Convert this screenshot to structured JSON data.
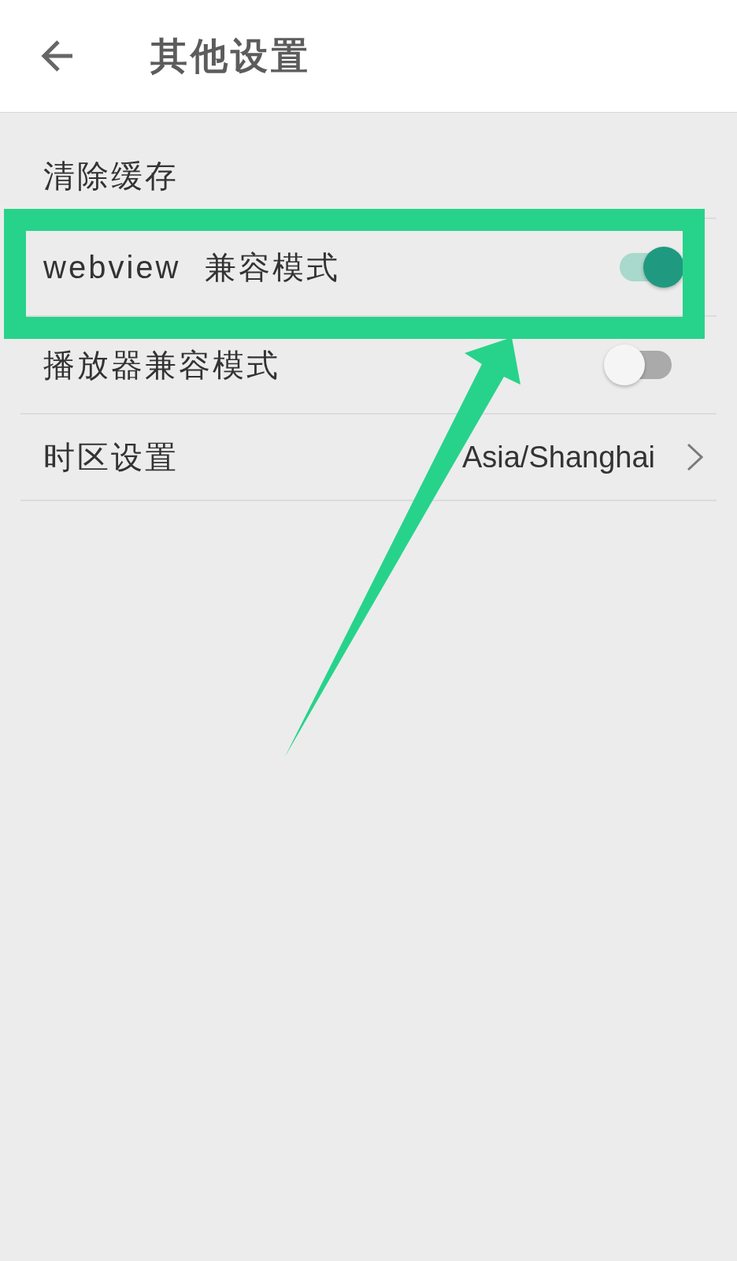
{
  "header": {
    "title": "其他设置"
  },
  "settings": [
    {
      "kind": "action",
      "label": "清除缓存"
    },
    {
      "kind": "toggle",
      "label": "webview 兼容模式",
      "on": true
    },
    {
      "kind": "toggle",
      "label": "播放器兼容模式",
      "on": false
    },
    {
      "kind": "link",
      "label": "时区设置",
      "value": "Asia/Shanghai"
    }
  ]
}
